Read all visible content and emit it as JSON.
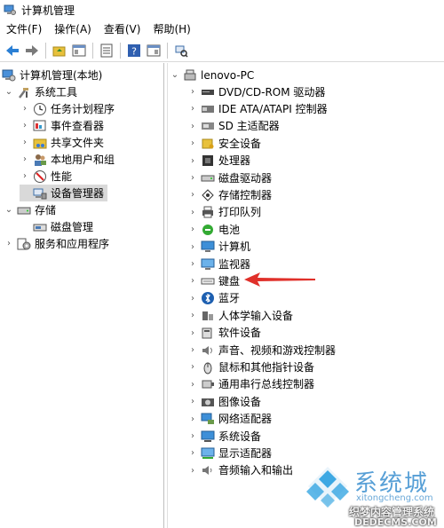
{
  "window": {
    "title": "计算机管理"
  },
  "menu": [
    "文件(F)",
    "操作(A)",
    "查看(V)",
    "帮助(H)"
  ],
  "left_tree": [
    {
      "label": "计算机管理(本地)",
      "icon": "computer-management-icon"
    },
    {
      "label": "系统工具",
      "icon": "tools-icon"
    },
    {
      "label": "任务计划程序",
      "icon": "clock-icon"
    },
    {
      "label": "事件查看器",
      "icon": "event-viewer-icon"
    },
    {
      "label": "共享文件夹",
      "icon": "shared-folder-icon"
    },
    {
      "label": "本地用户和组",
      "icon": "users-icon"
    },
    {
      "label": "性能",
      "icon": "performance-icon"
    },
    {
      "label": "设备管理器",
      "icon": "device-manager-icon"
    },
    {
      "label": "存储",
      "icon": "storage-icon"
    },
    {
      "label": "磁盘管理",
      "icon": "disk-management-icon"
    },
    {
      "label": "服务和应用程序",
      "icon": "services-icon"
    }
  ],
  "device_root": "lenovo-PC",
  "devices": [
    {
      "label": "DVD/CD-ROM 驱动器",
      "icon": "dvd-drive-icon"
    },
    {
      "label": "IDE ATA/ATAPI 控制器",
      "icon": "ide-controller-icon"
    },
    {
      "label": "SD 主适配器",
      "icon": "sd-adapter-icon"
    },
    {
      "label": "安全设备",
      "icon": "security-device-icon"
    },
    {
      "label": "处理器",
      "icon": "processor-icon"
    },
    {
      "label": "磁盘驱动器",
      "icon": "disk-drive-icon"
    },
    {
      "label": "存储控制器",
      "icon": "storage-controller-icon"
    },
    {
      "label": "打印队列",
      "icon": "printer-icon"
    },
    {
      "label": "电池",
      "icon": "battery-icon"
    },
    {
      "label": "计算机",
      "icon": "computer-icon"
    },
    {
      "label": "监视器",
      "icon": "monitor-icon"
    },
    {
      "label": "键盘",
      "icon": "keyboard-icon"
    },
    {
      "label": "蓝牙",
      "icon": "bluetooth-icon"
    },
    {
      "label": "人体学输入设备",
      "icon": "hid-icon"
    },
    {
      "label": "软件设备",
      "icon": "software-device-icon"
    },
    {
      "label": "声音、视频和游戏控制器",
      "icon": "sound-icon"
    },
    {
      "label": "鼠标和其他指针设备",
      "icon": "mouse-icon"
    },
    {
      "label": "通用串行总线控制器",
      "icon": "usb-icon"
    },
    {
      "label": "图像设备",
      "icon": "imaging-icon"
    },
    {
      "label": "网络适配器",
      "icon": "network-adapter-icon"
    },
    {
      "label": "系统设备",
      "icon": "system-device-icon"
    },
    {
      "label": "显示适配器",
      "icon": "display-adapter-icon"
    },
    {
      "label": "音频输入和输出",
      "icon": "audio-io-icon"
    }
  ],
  "watermark": {
    "brand": "系统城",
    "url": "xitongcheng.com",
    "site_cn": "织梦内容管理系统",
    "site_en": "DEDECMS.COM"
  }
}
